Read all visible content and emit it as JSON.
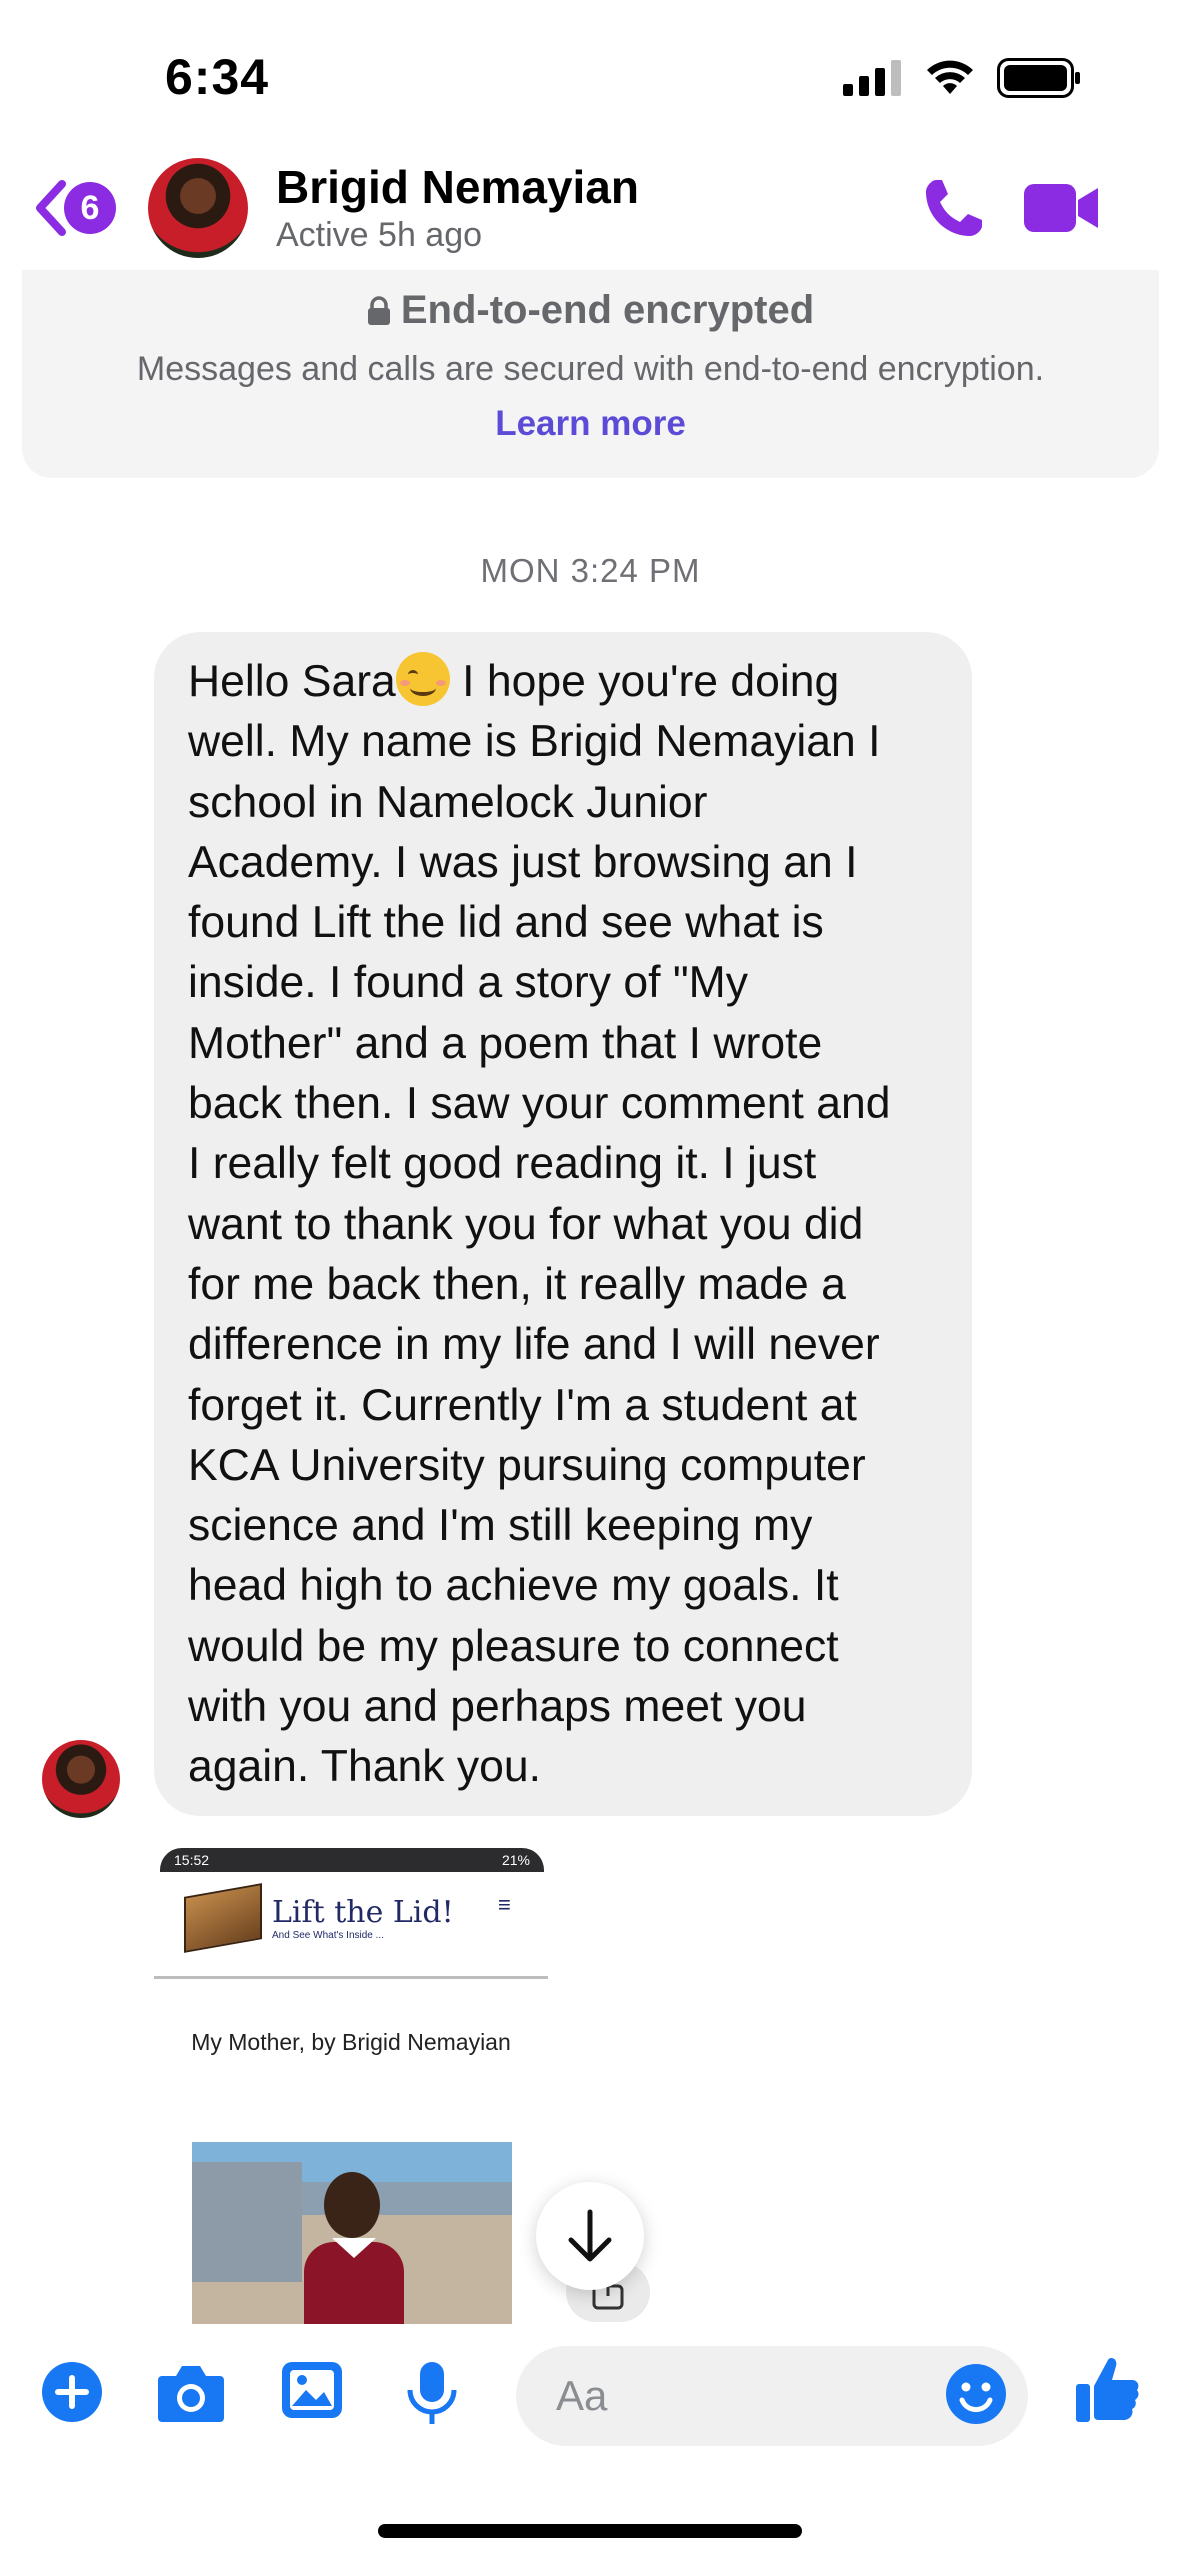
{
  "status_bar": {
    "time": "6:34"
  },
  "header": {
    "back_badge_count": "6",
    "contact_name": "Brigid Nemayian",
    "contact_status": "Active 5h ago"
  },
  "encryption_notice": {
    "title": "End-to-end encrypted",
    "description": "Messages and calls are secured with end-to-end encryption.",
    "link": "Learn more"
  },
  "conversation": {
    "timestamp": "MON 3:24 PM",
    "message": {
      "greeting": "Hello Sara",
      "text_after_emoji": " I hope you're doing\nwell. My name is Brigid Nemayian I\nschool in  Namelock Junior\nAcademy. I was just browsing an I\nfound Lift the lid and see what is\ninside. I found a story of \"My\nMother\" and a poem that I wrote\nback then. I saw your comment and\nI really felt good reading it. I just\nwant to thank you for what you did\nfor me back then, it really made a\ndifference in my life and I will never\nforget it. Currently I'm a student at\nKCA University pursuing computer\nscience and I'm still keeping my\nhead high to achieve my goals. It\nwould be my pleasure to connect\nwith you and perhaps meet you\nagain. Thank you."
    },
    "attachment": {
      "phone_time": "15:52",
      "phone_battery": "21%",
      "logo_title": "Lift the Lid!",
      "logo_subtitle": "And See What's Inside ...",
      "heading": "My Mother, by Brigid Nemayian"
    }
  },
  "composer": {
    "placeholder": "Aa"
  },
  "colors": {
    "accent_purple": "#8b2be2",
    "messenger_blue": "#1877f2",
    "link_purple": "#5b4bd6"
  }
}
